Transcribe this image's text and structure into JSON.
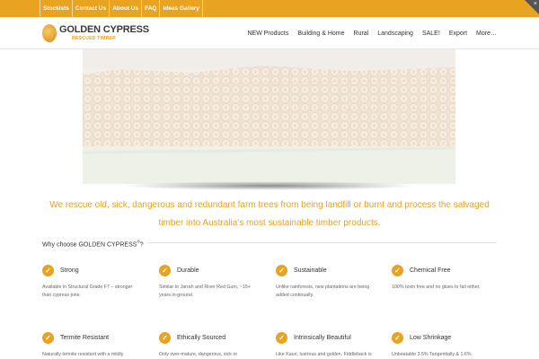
{
  "topbar": {
    "links": [
      "Stockists",
      "Contact Us",
      "About Us",
      "FAQ",
      "Ideas Gallery"
    ],
    "corner_icon": "close-icon"
  },
  "header": {
    "logo_title": "GOLDEN CYPRESS",
    "logo_subtitle": "RESCUED TIMBER",
    "nav": [
      "NEW Products",
      "Building & Home",
      "Rural",
      "Landscaping",
      "SALE!",
      "Export",
      "More…"
    ]
  },
  "hero": {
    "image": "stacked-timber-logs-photo"
  },
  "tagline": "We rescue old, sick, dangerous and redundant farm trees from being landfill or burnt and process the salvaged timber into Australia's most sustainable timber products.",
  "why": {
    "text": "Why choose GOLDEN CYPRESS",
    "mark": "®",
    "suffix": "?"
  },
  "features": [
    {
      "title": "Strong",
      "desc": "Available in Structural Grade F7 – stronger than cypress pine."
    },
    {
      "title": "Durable",
      "desc": "Similar to Jarrah and River Red Gum, ~15+ years in-ground."
    },
    {
      "title": "Sustainable",
      "desc": "Unlike rainforests, new plantations are being added continually."
    },
    {
      "title": "Chemical Free",
      "desc": "100% toxin free and no glues to fail either."
    },
    {
      "title": "Termite Resistant",
      "desc": "Naturally termite resistant with a mildly"
    },
    {
      "title": "Ethically Sourced",
      "desc": "Only over-mature, dangerous, sick or"
    },
    {
      "title": "Intrinsically Beautiful",
      "desc": "Like Kauri, lustrous and golden. Fiddleback is"
    },
    {
      "title": "Low Shrinkage",
      "desc": "Unbeatable 3.5% Tangentially & 1.6%"
    }
  ],
  "colors": {
    "accent": "#e8a320",
    "text": "#333333",
    "muted": "#666666"
  }
}
